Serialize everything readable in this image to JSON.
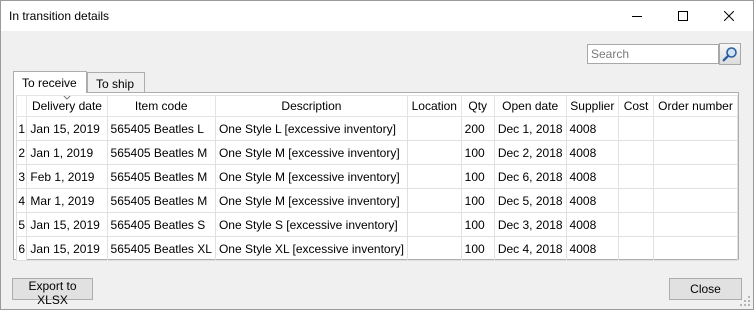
{
  "window": {
    "title": "In transition details"
  },
  "search": {
    "placeholder": "Search"
  },
  "tabs": [
    {
      "label": "To receive"
    },
    {
      "label": "To ship"
    }
  ],
  "grid": {
    "columns": [
      "Delivery date",
      "Item code",
      "Description",
      "Location",
      "Qty",
      "Open date",
      "Supplier",
      "Cost",
      "Order number"
    ],
    "rows": [
      {
        "num": "1",
        "cells": [
          "Jan 15, 2019",
          "565405 Beatles L",
          "One Style L [excessive inventory]",
          "",
          "200",
          "Dec 1, 2018",
          "4008",
          "",
          ""
        ]
      },
      {
        "num": "2",
        "cells": [
          "Jan 1, 2019",
          "565405 Beatles M",
          "One Style M [excessive inventory]",
          "",
          "100",
          "Dec 2, 2018",
          "4008",
          "",
          ""
        ]
      },
      {
        "num": "3",
        "cells": [
          "Feb 1, 2019",
          "565405 Beatles M",
          "One Style M [excessive inventory]",
          "",
          "100",
          "Dec 6, 2018",
          "4008",
          "",
          ""
        ]
      },
      {
        "num": "4",
        "cells": [
          "Mar 1, 2019",
          "565405 Beatles M",
          "One Style M [excessive inventory]",
          "",
          "100",
          "Dec 5, 2018",
          "4008",
          "",
          ""
        ]
      },
      {
        "num": "5",
        "cells": [
          "Jan 15, 2019",
          "565405 Beatles S",
          "One Style S [excessive inventory]",
          "",
          "100",
          "Dec 3, 2018",
          "4008",
          "",
          ""
        ]
      },
      {
        "num": "6",
        "cells": [
          "Jan 15, 2019",
          "565405 Beatles XL",
          "One Style XL [excessive inventory]",
          "",
          "100",
          "Dec 4, 2018",
          "4008",
          "",
          ""
        ]
      }
    ]
  },
  "buttons": {
    "export": "Export to XLSX",
    "close": "Close"
  }
}
